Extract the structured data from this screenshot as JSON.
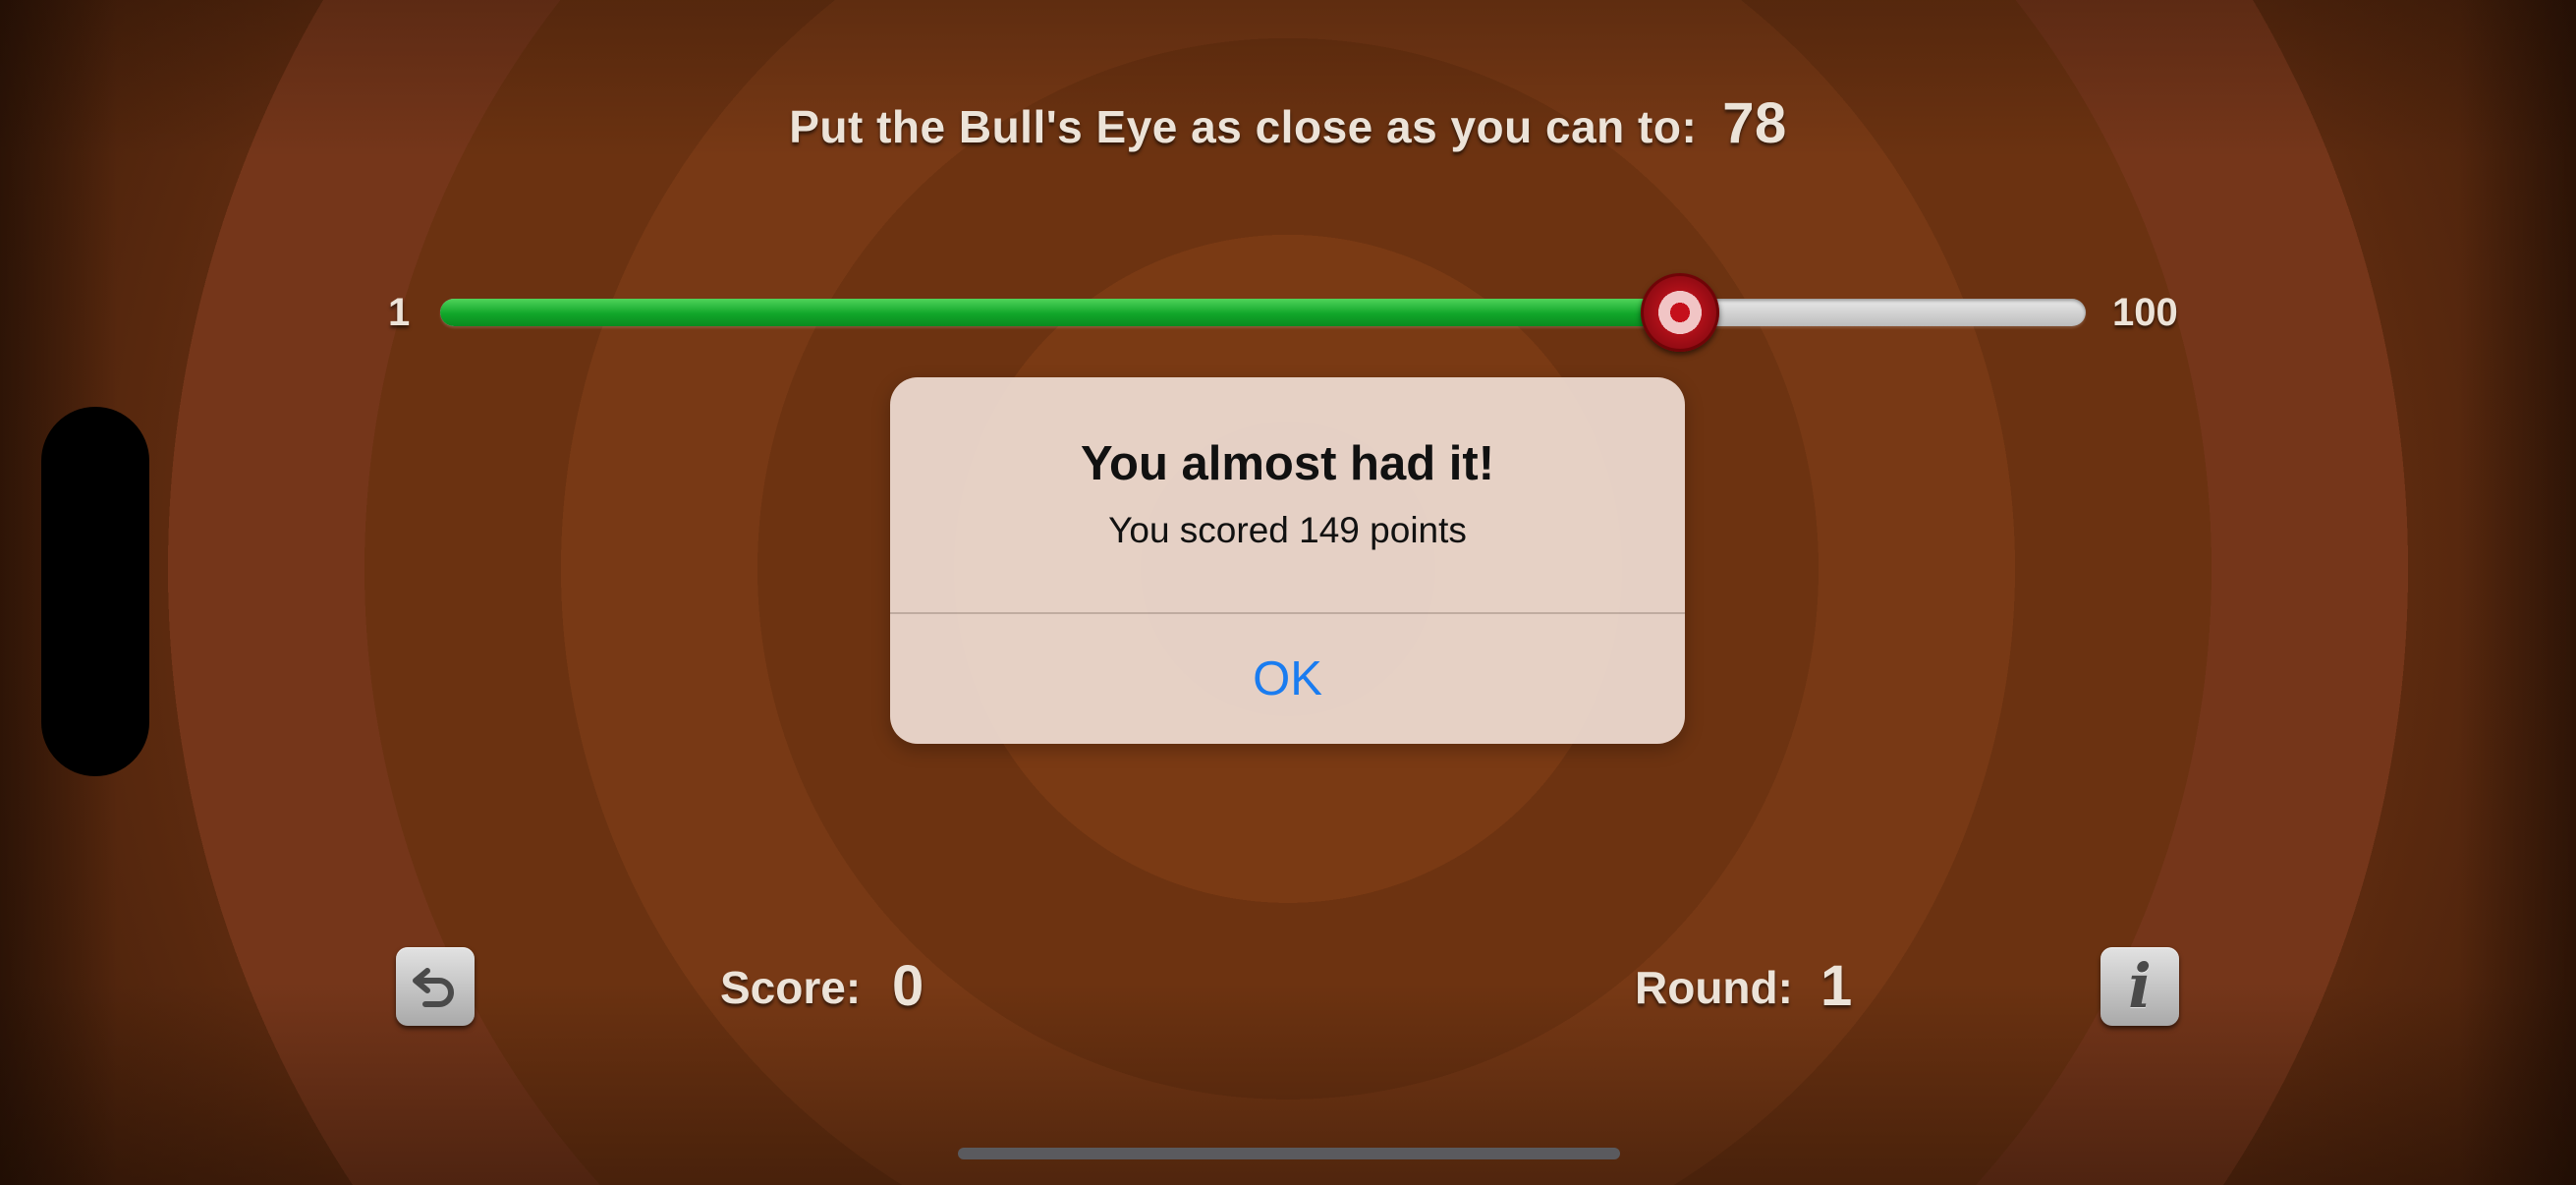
{
  "header": {
    "prompt": "Put the Bull's Eye as close as you can to:",
    "target_value": "78"
  },
  "slider": {
    "min_label": "1",
    "max_label": "100",
    "min": 1,
    "max": 100,
    "value": 76,
    "fill_color": "#11a62a",
    "thumb_color": "#c5101b"
  },
  "alert": {
    "title": "You almost had it!",
    "message": "You scored 149 points",
    "ok_label": "OK"
  },
  "footer": {
    "score_label": "Score:",
    "score_value": "0",
    "round_label": "Round:",
    "round_value": "1",
    "restart_icon": "restart-icon",
    "info_icon": "info-icon"
  },
  "colors": {
    "background": "#6f3512",
    "alert_button": "#1a7cf0"
  }
}
